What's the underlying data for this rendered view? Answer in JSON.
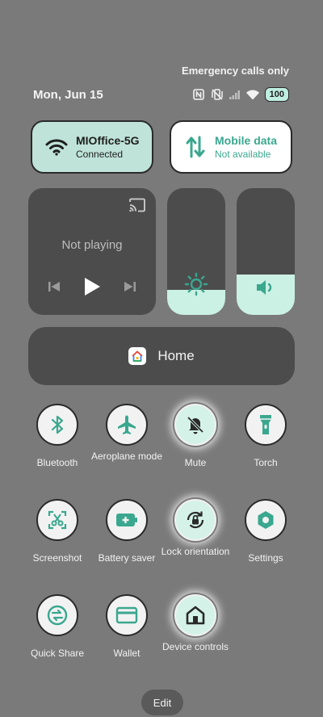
{
  "status": {
    "carrier_text": "Emergency calls only",
    "date": "Mon, Jun 15",
    "battery": "100"
  },
  "tiles": {
    "wifi": {
      "title": "MIOffice-5G",
      "subtitle": "Connected"
    },
    "mobile": {
      "title": "Mobile data",
      "subtitle": "Not available"
    }
  },
  "media": {
    "status": "Not playing"
  },
  "sliders": {
    "brightness_level": 0.2,
    "volume_level": 0.32
  },
  "home": {
    "label": "Home"
  },
  "quick_settings": [
    {
      "label": "Bluetooth",
      "icon": "bluetooth-icon",
      "active": false
    },
    {
      "label": "Aeroplane mode",
      "icon": "airplane-icon",
      "active": false
    },
    {
      "label": "Mute",
      "icon": "bell-off-icon",
      "active": true
    },
    {
      "label": "Torch",
      "icon": "flashlight-icon",
      "active": false
    },
    {
      "label": "Screenshot",
      "icon": "screenshot-icon",
      "active": false
    },
    {
      "label": "Battery saver",
      "icon": "battery-plus-icon",
      "active": false
    },
    {
      "label": "Lock orientation",
      "icon": "rotation-lock-icon",
      "active": true
    },
    {
      "label": "Settings",
      "icon": "settings-icon",
      "active": false
    },
    {
      "label": "Quick Share",
      "icon": "quick-share-icon",
      "active": false
    },
    {
      "label": "Wallet",
      "icon": "wallet-icon",
      "active": false
    },
    {
      "label": "Device controls",
      "icon": "home-icon",
      "active": true
    }
  ],
  "edit_label": "Edit",
  "colors": {
    "background": "#7a7a7a",
    "accent": "#3aa78f",
    "active_tile": "#bfe3d8",
    "dark_panel": "#4c4c4c"
  }
}
